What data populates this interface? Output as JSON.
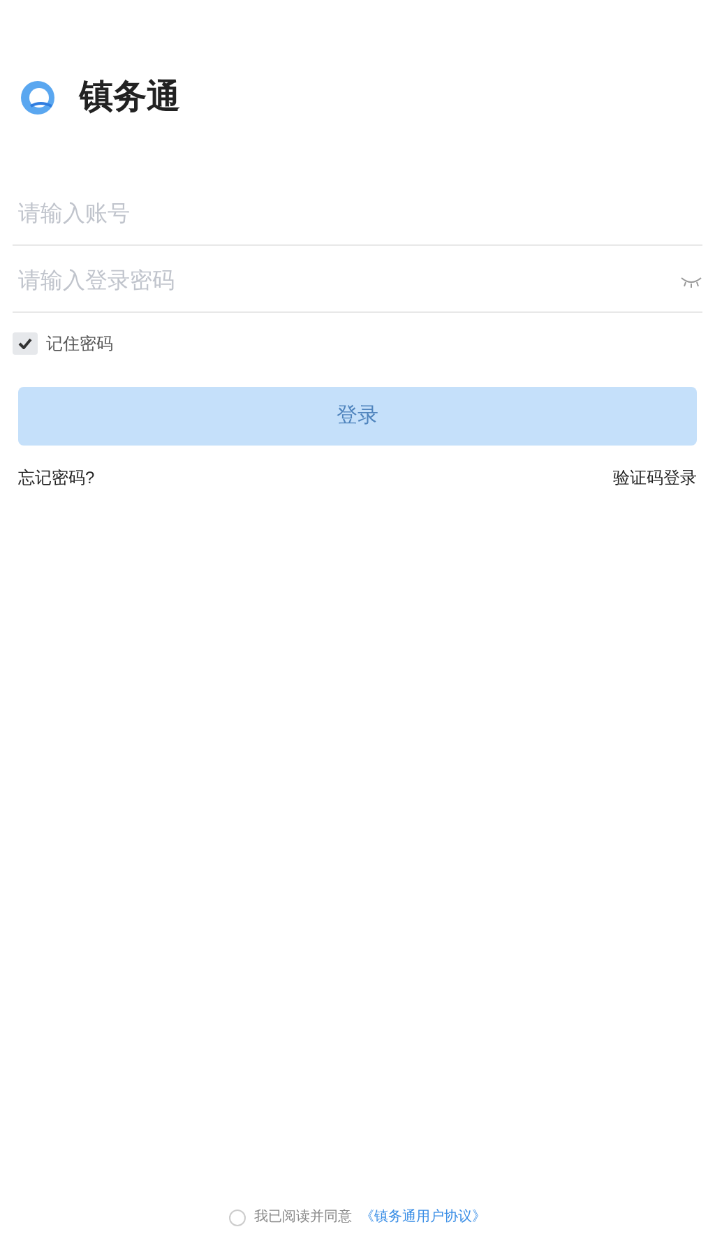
{
  "app": {
    "title": "镇务通"
  },
  "account_field": {
    "placeholder": "请输入账号"
  },
  "password_field": {
    "placeholder": "请输入登录密码",
    "visible": false
  },
  "remember": {
    "label": "记住密码",
    "checked": true
  },
  "login_button": {
    "label": "登录",
    "disabled": true
  },
  "links": {
    "forgot": "忘记密码?",
    "sms_login": "验证码登录"
  },
  "agreement": {
    "text": "我已阅读并同意",
    "link": "《镇务通用户协议》",
    "checked": false
  }
}
